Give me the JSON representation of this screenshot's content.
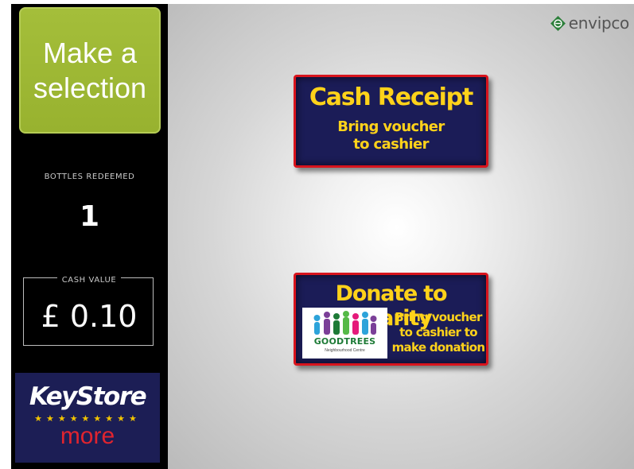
{
  "sidebar": {
    "make_selection": {
      "line1": "Make a",
      "line2": "selection"
    },
    "bottles": {
      "label": "BOTTLES REDEEMED",
      "value": "1"
    },
    "cash": {
      "label": "CASH VALUE",
      "value": "£ 0.10"
    },
    "keystore": {
      "title": "KeyStore",
      "stars": "★★★★★★★★★",
      "tagline": "more"
    }
  },
  "header": {
    "brand": "envipco",
    "brand_icon": "envipco-logo-icon"
  },
  "options": {
    "cash_receipt": {
      "title": "Cash Receipt",
      "line1": "Bring voucher",
      "line2": "to cashier"
    },
    "donate": {
      "title": "Donate to Charity",
      "line1": "Bring voucher",
      "line2": "to cashier to",
      "line3": "make donation",
      "logo_name": "GOODTREES",
      "logo_tagline": "Neighbourhood Centre"
    }
  },
  "colors": {
    "sidebar_bg": "#000000",
    "selection_green": "#9db635",
    "button_navy": "#1b1c57",
    "button_border": "#d8141d",
    "button_text": "#ffd21a",
    "keystore_navy": "#1c1e55",
    "keystore_red": "#e0242f",
    "goodtrees_green": "#1d7a36"
  }
}
